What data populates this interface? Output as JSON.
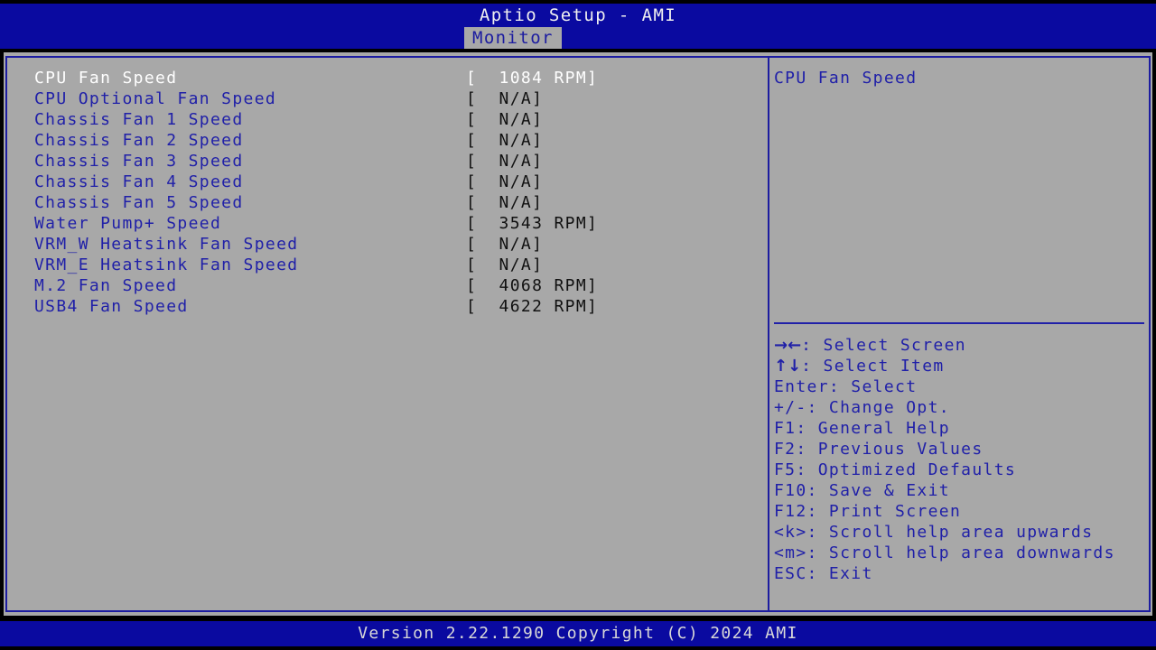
{
  "header": {
    "title": "Aptio Setup - AMI",
    "active_tab": "Monitor",
    "tabs": [
      "Monitor"
    ],
    "background_color": "#0a0aa0"
  },
  "theme": {
    "panel_background": "#a8a8a8",
    "text_blue": "#2020a8",
    "text_selected": "#ffffff",
    "value_black": "#101010",
    "border_blue": "#1c1ca0",
    "screen_background": "#000000"
  },
  "main": {
    "settings": [
      {
        "label": "CPU Fan Speed",
        "value": "[  1084 RPM]",
        "selected": true
      },
      {
        "label": "CPU Optional Fan Speed",
        "value": "[  N/A]",
        "selected": false
      },
      {
        "label": "Chassis Fan 1 Speed",
        "value": "[  N/A]",
        "selected": false
      },
      {
        "label": "Chassis Fan 2 Speed",
        "value": "[  N/A]",
        "selected": false
      },
      {
        "label": "Chassis Fan 3 Speed",
        "value": "[  N/A]",
        "selected": false
      },
      {
        "label": "Chassis Fan 4 Speed",
        "value": "[  N/A]",
        "selected": false
      },
      {
        "label": "Chassis Fan 5 Speed",
        "value": "[  N/A]",
        "selected": false
      },
      {
        "label": "Water Pump+ Speed",
        "value": "[  3543 RPM]",
        "selected": false
      },
      {
        "label": "VRM_W Heatsink Fan Speed",
        "value": "[  N/A]",
        "selected": false
      },
      {
        "label": "VRM_E Heatsink Fan Speed",
        "value": "[  N/A]",
        "selected": false
      },
      {
        "label": "M.2 Fan Speed",
        "value": "[  4068 RPM]",
        "selected": false
      },
      {
        "label": "USB4 Fan Speed",
        "value": "[  4622 RPM]",
        "selected": false
      }
    ]
  },
  "help": {
    "description": "CPU Fan Speed",
    "legend": [
      {
        "glyph": "→←",
        "text": ": Select Screen"
      },
      {
        "glyph": "↑↓",
        "text": ": Select Item"
      },
      {
        "glyph": "",
        "text": "Enter: Select"
      },
      {
        "glyph": "",
        "text": "+/-: Change Opt."
      },
      {
        "glyph": "",
        "text": "F1: General Help"
      },
      {
        "glyph": "",
        "text": "F2: Previous Values"
      },
      {
        "glyph": "",
        "text": "F5: Optimized Defaults"
      },
      {
        "glyph": "",
        "text": "F10: Save & Exit"
      },
      {
        "glyph": "",
        "text": "F12: Print Screen"
      },
      {
        "glyph": "",
        "text": "<k>: Scroll help area upwards"
      },
      {
        "glyph": "",
        "text": "<m>: Scroll help area downwards"
      },
      {
        "glyph": "",
        "text": "ESC: Exit"
      }
    ]
  },
  "footer": {
    "version_text": "Version 2.22.1290 Copyright (C) 2024 AMI"
  }
}
